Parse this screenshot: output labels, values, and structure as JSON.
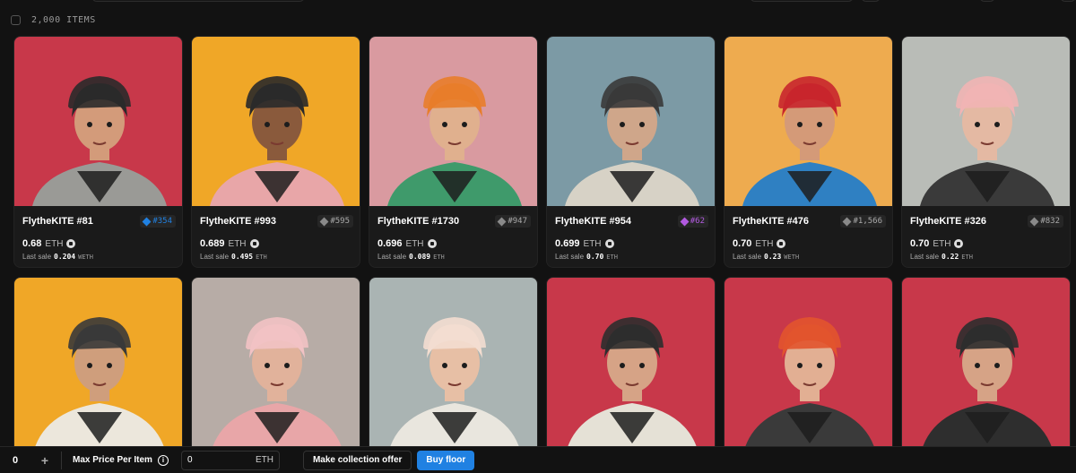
{
  "toolbar": {
    "items_count": "2,000 ITEMS"
  },
  "cards": [
    {
      "name": "FlytheKITE #81",
      "rank": "#354",
      "rank_color": "#2081e2",
      "price": "0.68",
      "unit": "ETH",
      "last_sale_label": "Last sale",
      "last_sale": "0.204",
      "last_unit": "WETH",
      "bg": "#c8384a",
      "skin": "#d39b7a",
      "hair": "#2a2a2a",
      "outfit": "#9a9a96"
    },
    {
      "name": "FlytheKITE #993",
      "rank": "#595",
      "rank_color": "#8a8a8a",
      "price": "0.689",
      "unit": "ETH",
      "last_sale_label": "Last sale",
      "last_sale": "0.495",
      "last_unit": "ETH",
      "bg": "#f0a727",
      "skin": "#8a5a3c",
      "hair": "#2a2a2a",
      "outfit": "#e8a6a8"
    },
    {
      "name": "FlytheKITE #1730",
      "rank": "#947",
      "rank_color": "#8a8a8a",
      "price": "0.696",
      "unit": "ETH",
      "last_sale_label": "Last sale",
      "last_sale": "0.089",
      "last_unit": "ETH",
      "bg": "#d99aa0",
      "skin": "#e0b08e",
      "hair": "#e87d2a",
      "outfit": "#3f9a6b"
    },
    {
      "name": "FlytheKITE #954",
      "rank": "#62",
      "rank_color": "#b25ae0",
      "price": "0.699",
      "unit": "ETH",
      "last_sale_label": "Last sale",
      "last_sale": "0.70",
      "last_unit": "ETH",
      "bg": "#7c9aa5",
      "skin": "#cfa68a",
      "hair": "#3a3a3a",
      "outfit": "#d7d2c6"
    },
    {
      "name": "FlytheKITE #476",
      "rank": "#1,566",
      "rank_color": "#8a8a8a",
      "price": "0.70",
      "unit": "ETH",
      "last_sale_label": "Last sale",
      "last_sale": "0.23",
      "last_unit": "WETH",
      "bg": "#eeab4f",
      "skin": "#d49a78",
      "hair": "#c8262c",
      "outfit": "#2f80c2"
    },
    {
      "name": "FlytheKITE #326",
      "rank": "#832",
      "rank_color": "#8a8a8a",
      "price": "0.70",
      "unit": "ETH",
      "last_sale_label": "Last sale",
      "last_sale": "0.22",
      "last_unit": "ETH",
      "bg": "#b9bcb7",
      "skin": "#e4b9a3",
      "hair": "#f1b4b4",
      "outfit": "#3a3a3a"
    },
    {
      "bg": "#f0a727",
      "skin": "#cf9e7c",
      "hair": "#3a3a3a",
      "outfit": "#ece7dc"
    },
    {
      "bg": "#b7aca6",
      "skin": "#e1b29b",
      "hair": "#f2c2c4",
      "outfit": "#e8a6a8"
    },
    {
      "bg": "#aab4b3",
      "skin": "#e7bfa5",
      "hair": "#f3ddd0",
      "outfit": "#e9e6de"
    },
    {
      "bg": "#c8384a",
      "skin": "#d6a386",
      "hair": "#2e2e2e",
      "outfit": "#e5e1d6"
    },
    {
      "bg": "#c8384a",
      "skin": "#e2af93",
      "hair": "#e2542e",
      "outfit": "#3a3a3a"
    },
    {
      "bg": "#c8384a",
      "skin": "#d6a386",
      "hair": "#2e2e2e",
      "outfit": "#2e2e2e"
    }
  ],
  "bottom_bar": {
    "quantity": "0",
    "plus_icon": "+",
    "max_price_label": "Max Price Per Item",
    "price_value": "0",
    "price_unit": "ETH",
    "offer_button": "Make collection offer",
    "buy_button": "Buy floor"
  }
}
